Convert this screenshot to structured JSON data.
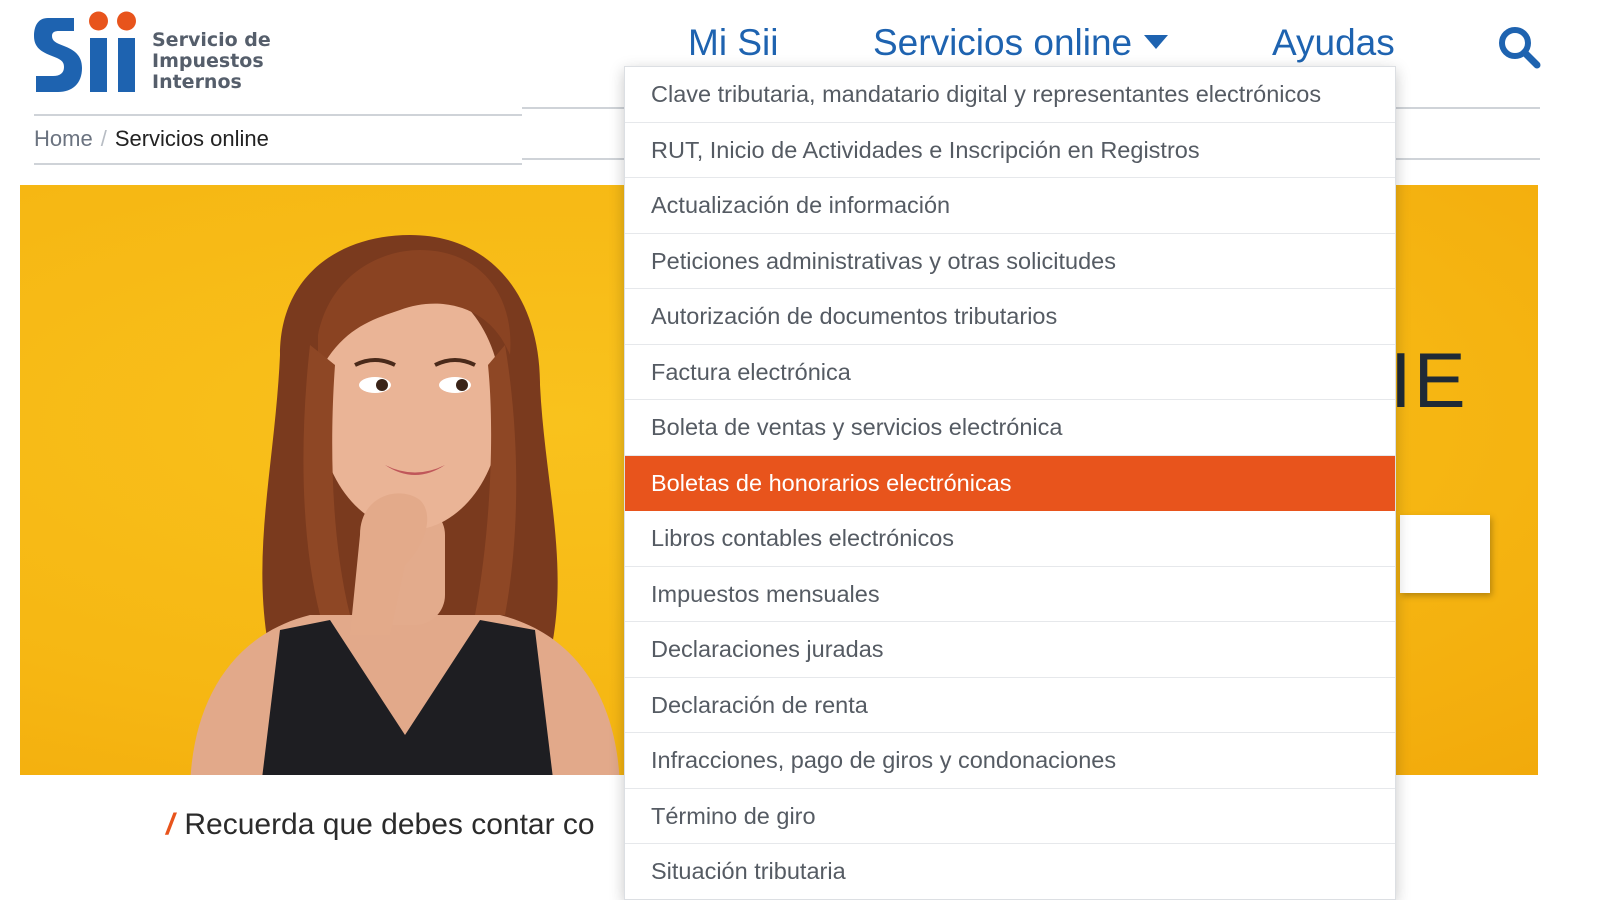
{
  "header": {
    "logo": {
      "wordmark": "Sii",
      "lines": [
        "Servicio de",
        "Impuestos",
        "Internos"
      ],
      "colors": {
        "blue": "#1e63b0",
        "orange": "#e8541c",
        "text": "#555e6b"
      }
    },
    "nav": {
      "mi_sii": "Mi Sii",
      "servicios_online": "Servicios online",
      "ayudas": "Ayudas"
    },
    "search_icon": "search-icon"
  },
  "breadcrumb": {
    "home": "Home",
    "separator": "/",
    "current": "Servicios online"
  },
  "dropdown": {
    "active_index": 7,
    "accent_color": "#e8541c",
    "items": [
      "Clave tributaria, mandatario digital y representantes electrónicos",
      "RUT, Inicio de Actividades e Inscripción en Registros",
      "Actualización de información",
      "Peticiones administrativas y otras solicitudes",
      "Autorización de documentos tributarios",
      "Factura electrónica",
      "Boleta de ventas y servicios electrónica",
      "Boletas de honorarios electrónicas",
      "Libros contables electrónicos",
      "Impuestos mensuales",
      "Declaraciones juradas",
      "Declaración de renta",
      "Infracciones, pago de giros y condonaciones",
      "Término de giro",
      "Situación tributaria"
    ]
  },
  "hero": {
    "partial_text": "IE",
    "background_color": "#f6b713"
  },
  "notice": {
    "slash": "/",
    "text": "Recuerda que debes contar co"
  }
}
